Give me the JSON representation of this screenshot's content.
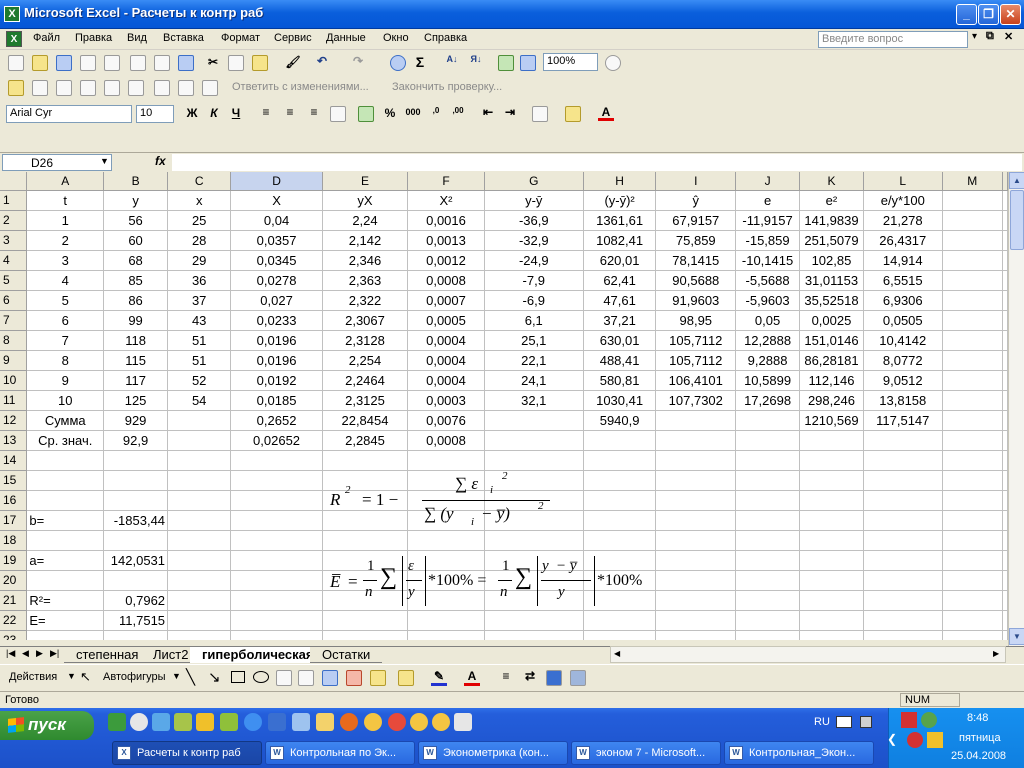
{
  "window": {
    "title": "Microsoft Excel - Расчеты к контр раб",
    "app_icon": "excel-icon",
    "buttons": {
      "minimize": "_",
      "restore": "❐",
      "close": "✕"
    }
  },
  "menu": {
    "items": [
      "Файл",
      "Правка",
      "Вид",
      "Вставка",
      "Формат",
      "Сервис",
      "Данные",
      "Окно",
      "Справка"
    ],
    "help_placeholder": "Введите вопрос"
  },
  "toolbar": {
    "zoom": "100%",
    "font": "Arial Cyr",
    "font_size": "10",
    "reply_with_changes": "Ответить с изменениями...",
    "end_review": "Закончить проверку...",
    "bold": "Ж",
    "italic": "К",
    "underline": "Ч",
    "currency": "%",
    "thousands": "000"
  },
  "formula_bar": {
    "cell": "D26",
    "fx": "fx",
    "content": ""
  },
  "sheet": {
    "columns": [
      "A",
      "B",
      "C",
      "D",
      "E",
      "F",
      "G",
      "H",
      "I",
      "J",
      "K",
      "L",
      "M"
    ],
    "selected_column": "D",
    "rows": [
      {
        "n": "1",
        "cells": [
          "t",
          "y",
          "x",
          "X",
          "yX",
          "X²",
          "y-ȳ",
          "(y-ȳ)²",
          "ŷ",
          "e",
          "e²",
          "e/y*100",
          ""
        ]
      },
      {
        "n": "2",
        "cells": [
          "1",
          "56",
          "25",
          "0,04",
          "2,24",
          "0,0016",
          "-36,9",
          "1361,61",
          "67,9157",
          "-11,9157",
          "141,9839",
          "21,278",
          ""
        ]
      },
      {
        "n": "3",
        "cells": [
          "2",
          "60",
          "28",
          "0,0357",
          "2,142",
          "0,0013",
          "-32,9",
          "1082,41",
          "75,859",
          "-15,859",
          "251,5079",
          "26,4317",
          ""
        ]
      },
      {
        "n": "4",
        "cells": [
          "3",
          "68",
          "29",
          "0,0345",
          "2,346",
          "0,0012",
          "-24,9",
          "620,01",
          "78,1415",
          "-10,1415",
          "102,85",
          "14,914",
          ""
        ]
      },
      {
        "n": "5",
        "cells": [
          "4",
          "85",
          "36",
          "0,0278",
          "2,363",
          "0,0008",
          "-7,9",
          "62,41",
          "90,5688",
          "-5,5688",
          "31,01153",
          "6,5515",
          ""
        ]
      },
      {
        "n": "6",
        "cells": [
          "5",
          "86",
          "37",
          "0,027",
          "2,322",
          "0,0007",
          "-6,9",
          "47,61",
          "91,9603",
          "-5,9603",
          "35,52518",
          "6,9306",
          ""
        ]
      },
      {
        "n": "7",
        "cells": [
          "6",
          "99",
          "43",
          "0,0233",
          "2,3067",
          "0,0005",
          "6,1",
          "37,21",
          "98,95",
          "0,05",
          "0,0025",
          "0,0505",
          ""
        ]
      },
      {
        "n": "8",
        "cells": [
          "7",
          "118",
          "51",
          "0,0196",
          "2,3128",
          "0,0004",
          "25,1",
          "630,01",
          "105,7112",
          "12,2888",
          "151,0146",
          "10,4142",
          ""
        ]
      },
      {
        "n": "9",
        "cells": [
          "8",
          "115",
          "51",
          "0,0196",
          "2,254",
          "0,0004",
          "22,1",
          "488,41",
          "105,7112",
          "9,2888",
          "86,28181",
          "8,0772",
          ""
        ]
      },
      {
        "n": "10",
        "cells": [
          "9",
          "117",
          "52",
          "0,0192",
          "2,2464",
          "0,0004",
          "24,1",
          "580,81",
          "106,4101",
          "10,5899",
          "112,146",
          "9,0512",
          ""
        ]
      },
      {
        "n": "11",
        "cells": [
          "10",
          "125",
          "54",
          "0,0185",
          "2,3125",
          "0,0003",
          "32,1",
          "1030,41",
          "107,7302",
          "17,2698",
          "298,246",
          "13,8158",
          ""
        ]
      },
      {
        "n": "12",
        "cells": [
          "Сумма",
          "929",
          "",
          "0,2652",
          "22,8454",
          "0,0076",
          "",
          "5940,9",
          "",
          "",
          "1210,569",
          "117,5147",
          ""
        ]
      },
      {
        "n": "13",
        "cells": [
          "Ср. знач.",
          "92,9",
          "",
          "0,02652",
          "2,2845",
          "0,0008",
          "",
          "",
          "",
          "",
          "",
          "",
          ""
        ]
      },
      {
        "n": "14",
        "cells": [
          "",
          "",
          "",
          "",
          "",
          "",
          "",
          "",
          "",
          "",
          "",
          "",
          ""
        ]
      },
      {
        "n": "15",
        "cells": [
          "",
          "",
          "",
          "",
          "",
          "",
          "",
          "",
          "",
          "",
          "",
          "",
          ""
        ]
      },
      {
        "n": "16",
        "cells": [
          "",
          "",
          "",
          "",
          "",
          "",
          "",
          "",
          "",
          "",
          "",
          "",
          ""
        ]
      },
      {
        "n": "17",
        "cells": [
          "b=",
          "-1853,44",
          "",
          "",
          "",
          "",
          "",
          "",
          "",
          "",
          "",
          "",
          ""
        ]
      },
      {
        "n": "18",
        "cells": [
          "",
          "",
          "",
          "",
          "",
          "",
          "",
          "",
          "",
          "",
          "",
          "",
          ""
        ]
      },
      {
        "n": "19",
        "cells": [
          "a=",
          "142,0531",
          "",
          "",
          "",
          "",
          "",
          "",
          "",
          "",
          "",
          "",
          ""
        ]
      },
      {
        "n": "20",
        "cells": [
          "",
          "",
          "",
          "",
          "",
          "",
          "",
          "",
          "",
          "",
          "",
          "",
          ""
        ]
      },
      {
        "n": "21",
        "cells": [
          "R²=",
          "0,7962",
          "",
          "",
          "",
          "",
          "",
          "",
          "",
          "",
          "",
          "",
          ""
        ]
      },
      {
        "n": "22",
        "cells": [
          "E=",
          "11,7515",
          "",
          "",
          "",
          "",
          "",
          "",
          "",
          "",
          "",
          "",
          ""
        ]
      },
      {
        "n": "23",
        "cells": [
          "",
          "",
          "",
          "",
          "",
          "",
          "",
          "",
          "",
          "",
          "",
          "",
          ""
        ]
      },
      {
        "n": "24",
        "cells": [
          "",
          "",
          "",
          "",
          "",
          "",
          "",
          "",
          "",
          "",
          "",
          "",
          ""
        ]
      },
      {
        "n": "25",
        "cells": [
          "",
          "",
          "",
          "",
          "",
          "",
          "",
          "",
          "",
          "",
          "",
          "",
          ""
        ]
      }
    ]
  },
  "formulas": {
    "r2_lhs": "R",
    "r2_sup": "2",
    "r2_eq": "= 1 −",
    "r2_num": "∑ ε",
    "r2_num_sub": "i",
    "r2_num_sup": "2",
    "r2_den": "∑ (y",
    "r2_den_sub": "i",
    "r2_den_tail": "− y̅)",
    "r2_den_sup": "2",
    "e_lhs": "E̅",
    "e_eq": "=",
    "e_n1": "1",
    "e_d1": "n",
    "e_sum": "∑",
    "e_abs1_num": "ε",
    "e_abs1_den": "y",
    "e_i": "i",
    "e_mult": "*100% =",
    "e_abs2_num": "y",
    "e_abs2_num_tail": "− y̅",
    "e_abs2_den": "y",
    "e_mult2": "*100%"
  },
  "tabs": {
    "items": [
      "степенная",
      "Лист2",
      "гиперболическая",
      "Остатки"
    ],
    "active": "гиперболическая"
  },
  "drawing": {
    "actions": "Действия",
    "autoshapes": "Автофигуры"
  },
  "status": {
    "left": "Готово",
    "num": "NUM"
  },
  "taskbar": {
    "start": "пуск",
    "tasks": [
      "Расчеты к контр раб",
      "Контрольная по Эк...",
      "Эконометрика (кон...",
      "эконом 7 - Microsoft...",
      "Контрольная_Экон..."
    ],
    "lang": "RU",
    "time": "8:48",
    "day": "пятница",
    "date": "25.04.2008"
  }
}
